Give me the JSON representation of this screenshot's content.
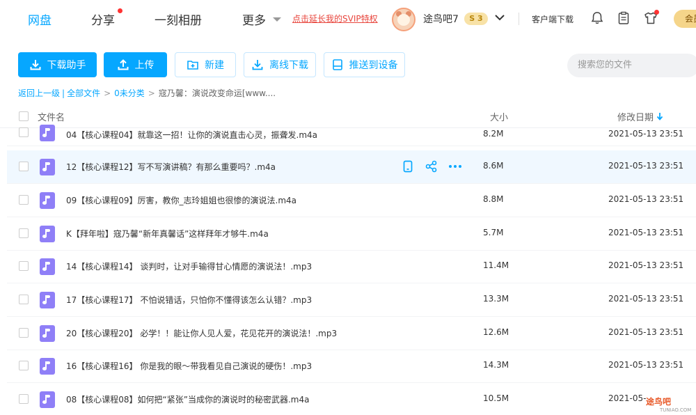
{
  "nav": {
    "items": [
      {
        "label": "网盘",
        "active": true
      },
      {
        "label": "分享"
      },
      {
        "label": "一刻相册"
      },
      {
        "label": "更多"
      }
    ],
    "promo": "点击延长我的SVIP特权",
    "username": "途鸟吧7",
    "coin_label": "S 3",
    "client_download": "客户端下载",
    "member_label": "会员"
  },
  "toolbar": {
    "download_helper": "下载助手",
    "upload": "上传",
    "new_folder": "新建",
    "offline_download": "离线下载",
    "push_to_device": "推送到设备",
    "search_placeholder": "搜索您的文件"
  },
  "breadcrumb": {
    "back": "返回上一级",
    "all_files": "全部文件",
    "uncategorized": "0未分类",
    "current": "寇乃馨：演说改变命运[www...."
  },
  "table": {
    "col_name": "文件名",
    "col_size": "大小",
    "col_date": "修改日期",
    "rows": [
      {
        "name": "04【核心课程04】就靠这一招！让你的演说直击心灵，振聋发.m4a",
        "size": "8.2M",
        "date": "2021-05-13 23:51"
      },
      {
        "name": "12【核心课程12】写不写演讲稿？有那么重要吗？.m4a",
        "size": "8.6M",
        "date": "2021-05-13 23:51"
      },
      {
        "name": "09【核心课程09】厉害，教你_志玲姐姐也很惨的演说法.m4a",
        "size": "8.8M",
        "date": "2021-05-13 23:51"
      },
      {
        "name": "K【拜年啦】寇乃馨“新年真馨话”这样拜年才够牛.m4a",
        "size": "5.7M",
        "date": "2021-05-13 23:51"
      },
      {
        "name": "14【核心课程14】 谈判时，让对手输得甘心情愿的演说法！.mp3",
        "size": "11.4M",
        "date": "2021-05-13 23:51"
      },
      {
        "name": "17【核心课程17】 不怕说错话，只怕你不懂得该怎么认错？.mp3",
        "size": "13.3M",
        "date": "2021-05-13 23:51"
      },
      {
        "name": "20【核心课程20】 必学！！能让你人见人爱，花见花开的演说法！.mp3",
        "size": "12.6M",
        "date": "2021-05-13 23:51"
      },
      {
        "name": "16【核心课程16】 你是我的眼～带我看见自己演说的硬伤！.mp3",
        "size": "14.3M",
        "date": "2021-05-13 23:51"
      },
      {
        "name": "08【核心课程08】如何把“紧张”当成你的演说时的秘密武器.m4a",
        "size": "10.5M",
        "date": "2021-05-"
      }
    ]
  },
  "watermark": {
    "main": "途鸟吧",
    "sub": "TUNIAO.COM"
  },
  "colors": {
    "accent": "#06a7ff",
    "promo": "#e8453c",
    "file_icon": "#8f7ff7"
  }
}
